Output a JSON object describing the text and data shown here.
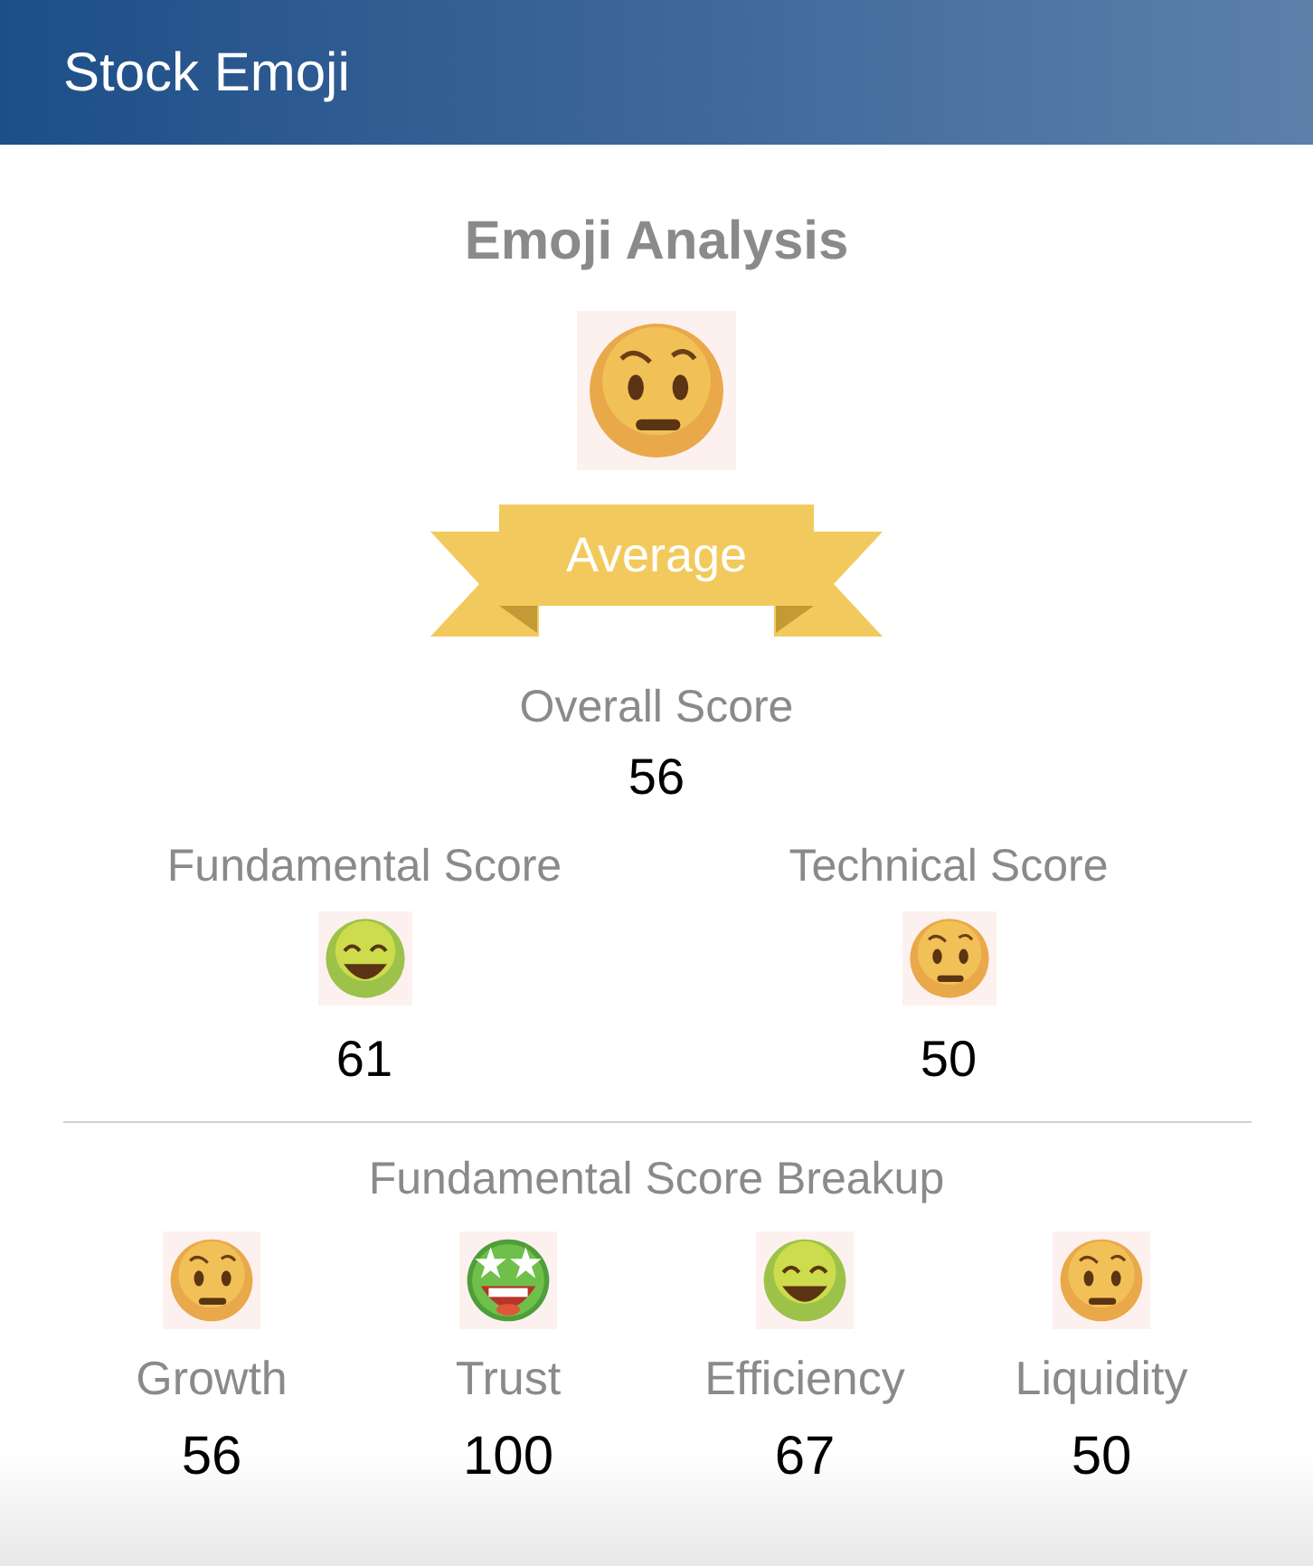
{
  "header": {
    "title": "Stock Emoji"
  },
  "analysis": {
    "title": "Emoji Analysis",
    "kind": "wary",
    "rating": "Average",
    "overall_label": "Overall Score",
    "overall_value": "56"
  },
  "scores": [
    {
      "label": "Fundamental Score",
      "kind": "smiling",
      "value": "61"
    },
    {
      "label": "Technical Score",
      "kind": "wary",
      "value": "50"
    }
  ],
  "breakup": {
    "title": "Fundamental Score Breakup",
    "items": [
      {
        "label": "Growth",
        "kind": "wary",
        "value": "56"
      },
      {
        "label": "Trust",
        "kind": "star-struck",
        "value": "100"
      },
      {
        "label": "Efficiency",
        "kind": "smiling",
        "value": "67"
      },
      {
        "label": "Liquidity",
        "kind": "wary",
        "value": "50"
      }
    ]
  }
}
